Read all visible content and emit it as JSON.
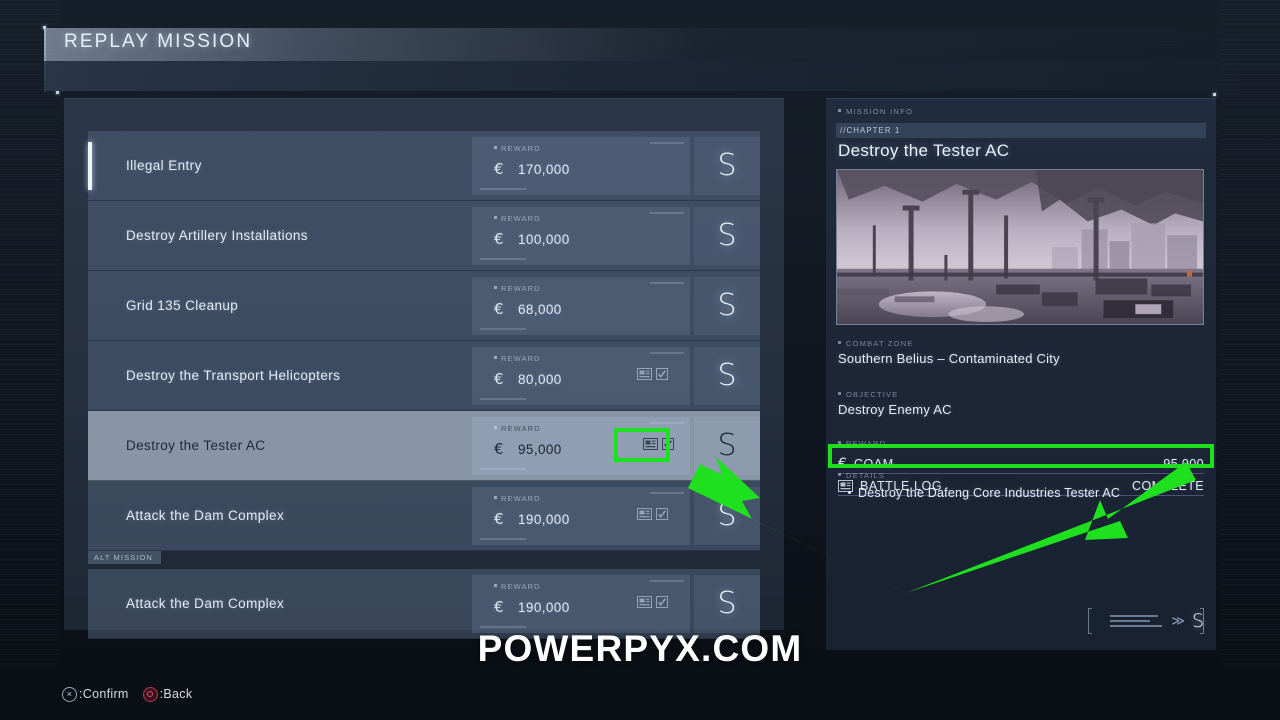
{
  "header": {
    "title": "REPLAY MISSION"
  },
  "mission_list": {
    "rows": [
      {
        "name": "Illegal Entry",
        "reward_label": "REWARD",
        "currency": "€",
        "amount": "170,000",
        "rank": "S",
        "has_battle_log": false,
        "selected": false,
        "cursor": true,
        "alt_tag": ""
      },
      {
        "name": "Destroy Artillery Installations",
        "reward_label": "REWARD",
        "currency": "€",
        "amount": "100,000",
        "rank": "S",
        "has_battle_log": false,
        "selected": false,
        "cursor": false,
        "alt_tag": ""
      },
      {
        "name": "Grid 135 Cleanup",
        "reward_label": "REWARD",
        "currency": "€",
        "amount": "68,000",
        "rank": "S",
        "has_battle_log": false,
        "selected": false,
        "cursor": false,
        "alt_tag": ""
      },
      {
        "name": "Destroy the Transport Helicopters",
        "reward_label": "REWARD",
        "currency": "€",
        "amount": "80,000",
        "rank": "S",
        "has_battle_log": true,
        "selected": false,
        "cursor": false,
        "alt_tag": ""
      },
      {
        "name": "Destroy the Tester AC",
        "reward_label": "REWARD",
        "currency": "€",
        "amount": "95,000",
        "rank": "S",
        "has_battle_log": true,
        "selected": true,
        "cursor": false,
        "alt_tag": ""
      },
      {
        "name": "Attack the Dam Complex",
        "reward_label": "REWARD",
        "currency": "€",
        "amount": "190,000",
        "rank": "S",
        "has_battle_log": true,
        "selected": false,
        "cursor": false,
        "alt_tag": ""
      },
      {
        "name": "Attack the Dam Complex",
        "reward_label": "REWARD",
        "currency": "€",
        "amount": "190,000",
        "rank": "S",
        "has_battle_log": true,
        "selected": false,
        "cursor": false,
        "alt_tag": "ALT MISSION"
      }
    ]
  },
  "info_panel": {
    "panel_label": "MISSION INFO",
    "chapter": "//CHAPTER 1",
    "title": "Destroy the Tester AC",
    "combat_zone_label": "COMBAT ZONE",
    "combat_zone": "Southern Belius – Contaminated City",
    "objective_label": "OBJECTIVE",
    "objective": "Destroy Enemy AC",
    "reward_label": "REWARD",
    "rewards": [
      {
        "icon": "euro-icon",
        "name": "COAM",
        "value": "95,000",
        "highlighted": false
      },
      {
        "icon": "battle-log-icon",
        "name": "BATTLE LOG",
        "value": "COMPLETE",
        "highlighted": true
      }
    ],
    "details_label": "DETAILS",
    "details": [
      "Destroy the Dafeng Core Industries Tester AC"
    ],
    "rank_footer": {
      "chevron": "≫",
      "rank": "S"
    }
  },
  "footer": {
    "hints": [
      {
        "button": "⨂",
        "glyph": "×",
        "label": ":Confirm",
        "kind": "cross"
      },
      {
        "button": "◎",
        "glyph": "",
        "label": ":Back",
        "kind": "circle"
      }
    ]
  },
  "watermark": {
    "text": "POWERPYX.COM"
  },
  "annotation": {
    "color": "#1EE01E",
    "boxes": [
      {
        "name": "list-battle-log-highlight"
      },
      {
        "name": "battle-log-row-highlight"
      }
    ]
  },
  "colors": {
    "accent_green": "#1EE01E",
    "panel_blue": "#546680",
    "selected_row": "#B0BED0",
    "text_primary": "#E6EDF6",
    "background": "#0C1219"
  }
}
